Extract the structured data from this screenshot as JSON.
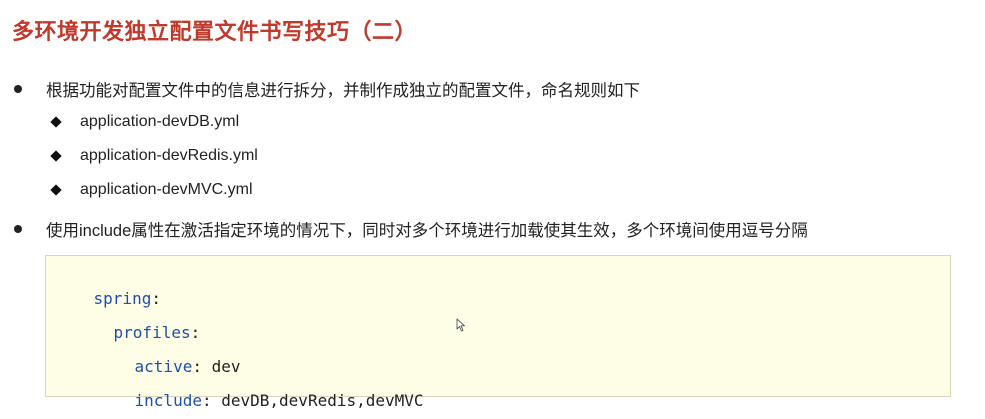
{
  "title": "多环境开发独立配置文件书写技巧（二）",
  "bullets": [
    {
      "text": "根据功能对配置文件中的信息进行拆分，并制作成独立的配置文件，命名规则如下",
      "sub_items": [
        "application-devDB.yml",
        "application-devRedis.yml",
        "application-devMVC.yml"
      ]
    },
    {
      "text": "使用include属性在激活指定环境的情况下，同时对多个环境进行加载使其生效，多个环境间使用逗号分隔"
    }
  ],
  "code": {
    "lines": [
      {
        "key": "spring",
        "sep": ":",
        "value": ""
      },
      {
        "key": "profiles",
        "sep": ":",
        "value": ""
      },
      {
        "key": "active",
        "sep": ":",
        "value": " dev"
      },
      {
        "key": "include",
        "sep": ":",
        "value": " devDB,devRedis,devMVC"
      }
    ]
  },
  "colors": {
    "title": "#c0392b",
    "code_key": "#1f4fa8",
    "code_background": "#fefde6"
  },
  "icons": {
    "bullet": "filled-circle",
    "sub_bullet": "filled-diamond",
    "cursor": "mouse-pointer-icon"
  }
}
